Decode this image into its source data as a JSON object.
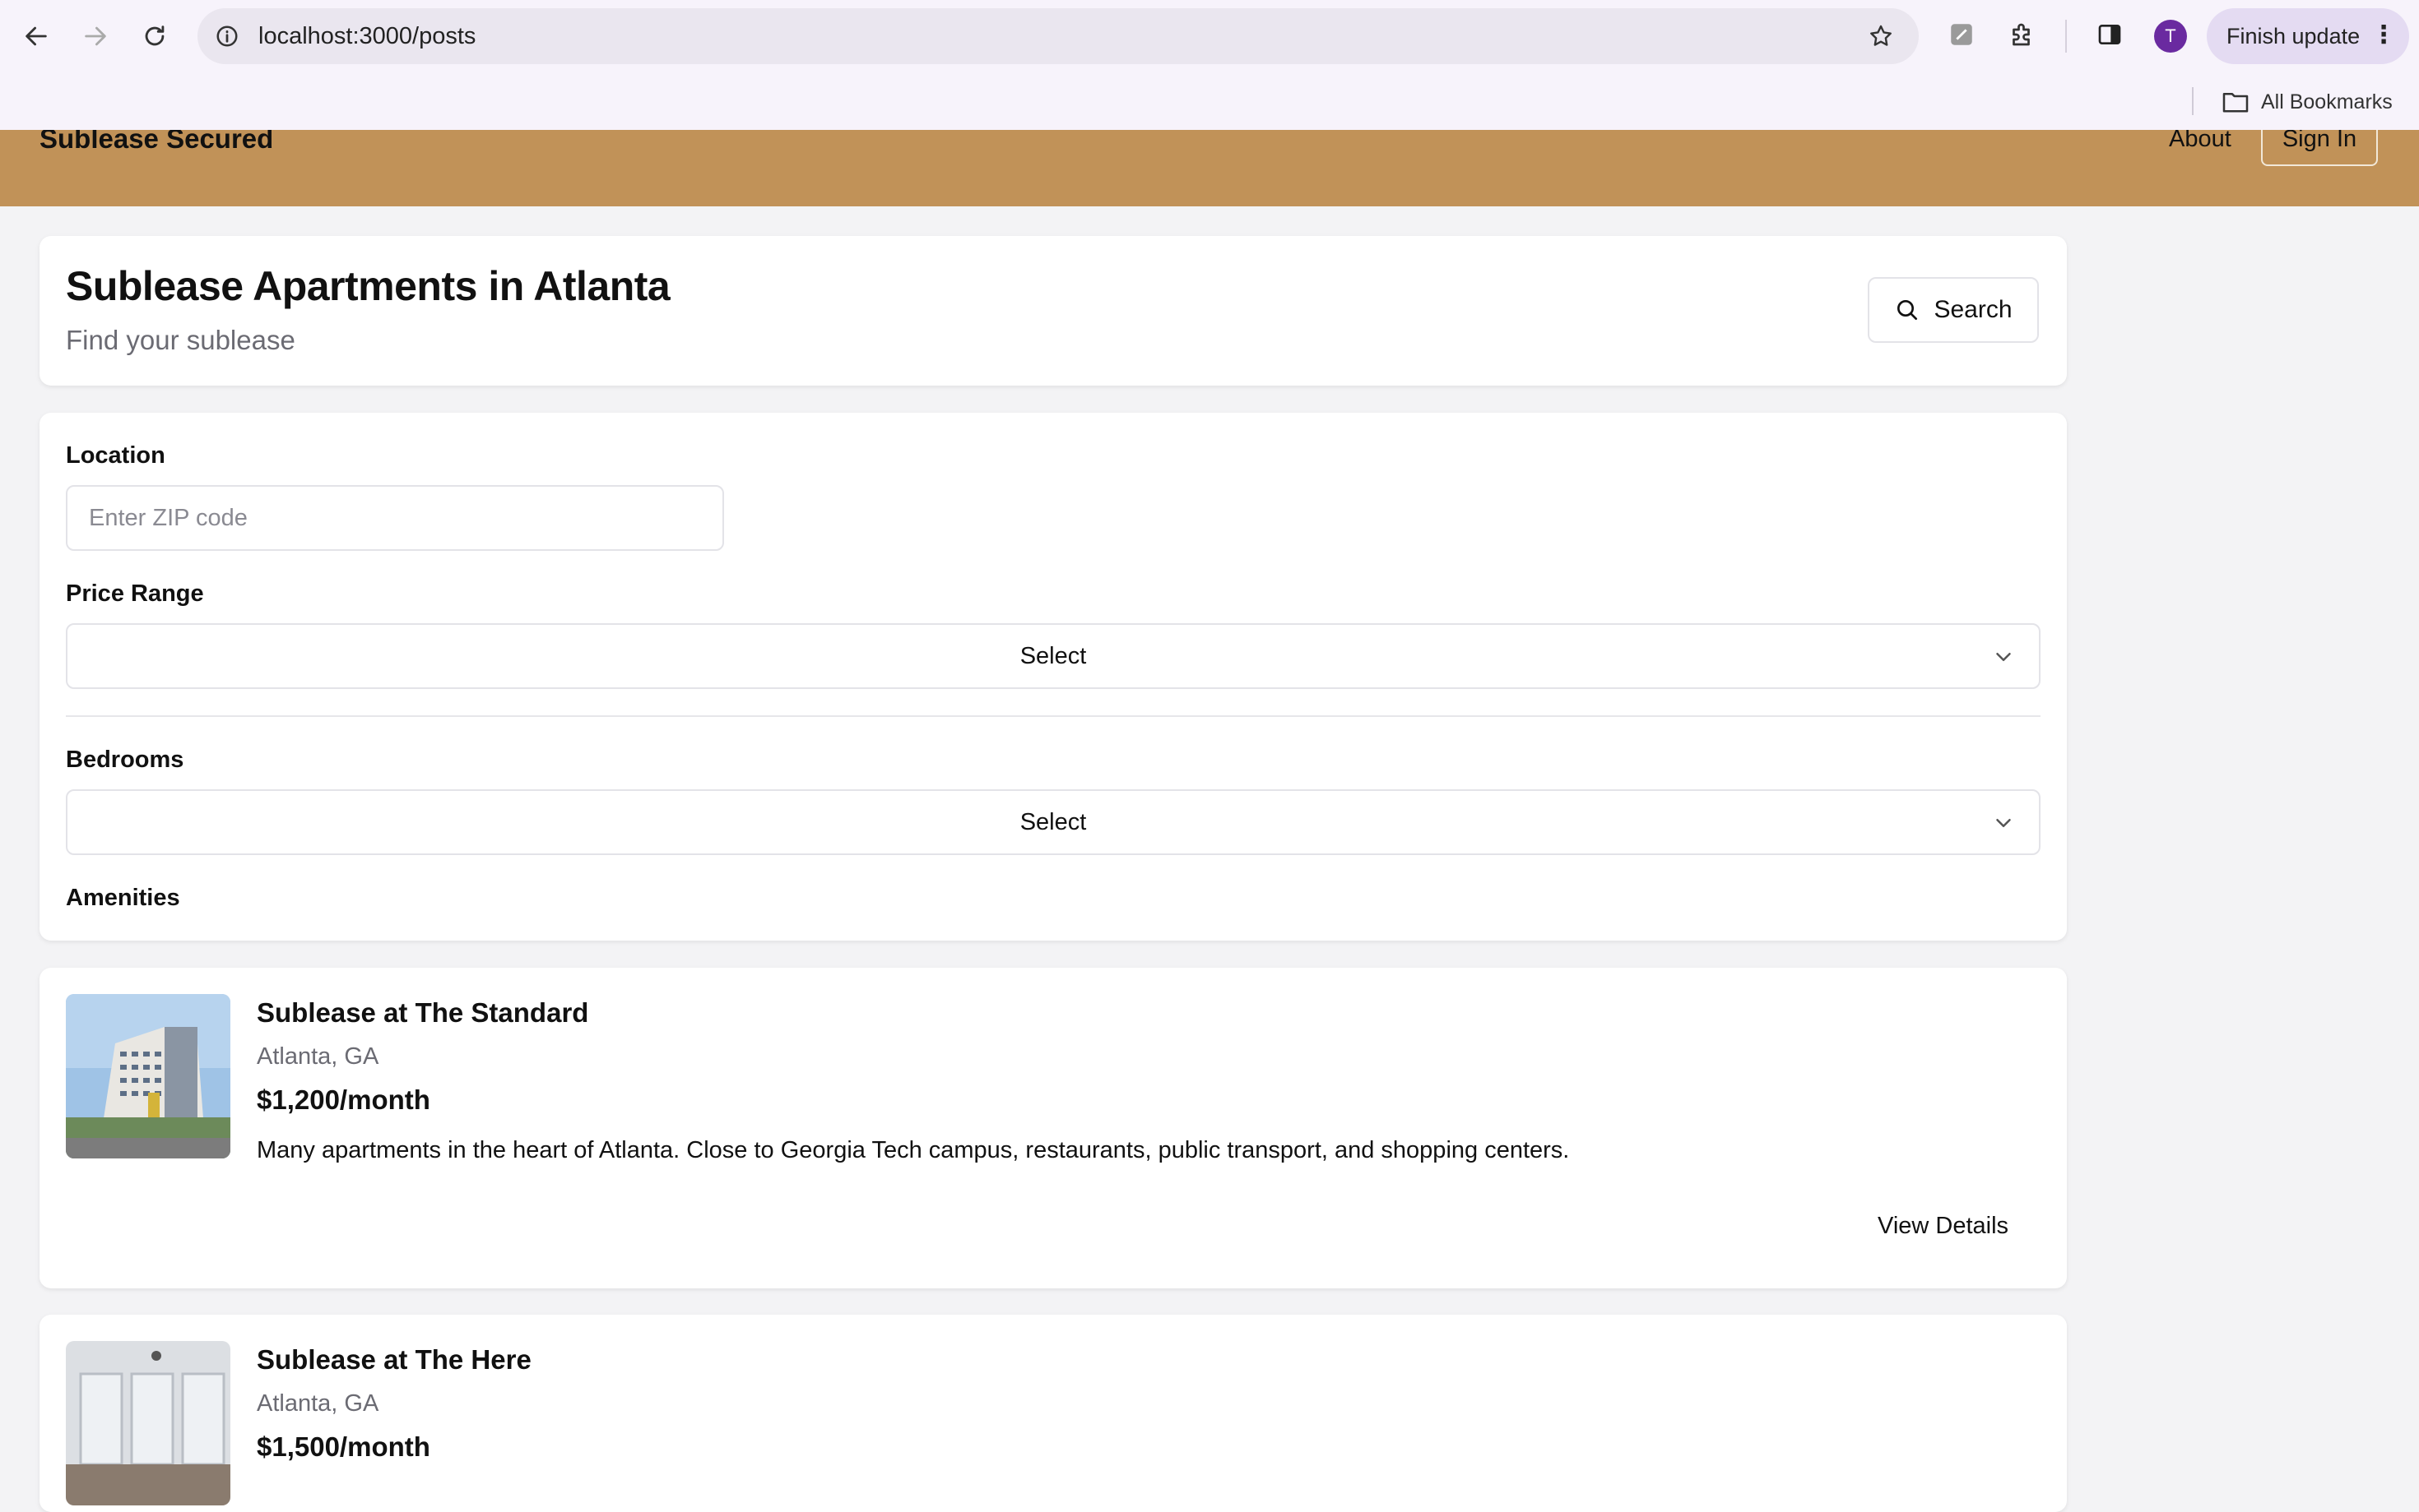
{
  "browser": {
    "url": "localhost:3000/posts",
    "profile_initial": "T",
    "finish_update_label": "Finish update",
    "bookmarks_label": "All Bookmarks"
  },
  "header": {
    "brand": "Sublease Secured",
    "nav_about": "About",
    "sign_in": "Sign In",
    "accent_color": "#c19258"
  },
  "hero": {
    "title": "Sublease Apartments in Atlanta",
    "subtitle": "Find your sublease",
    "search_label": "Search"
  },
  "filters": {
    "location_label": "Location",
    "zip_placeholder": "Enter ZIP code",
    "price_label": "Price Range",
    "price_value": "Select",
    "bedrooms_label": "Bedrooms",
    "bedrooms_value": "Select",
    "amenities_label": "Amenities"
  },
  "listings": [
    {
      "title": "Sublease at The Standard",
      "location": "Atlanta, GA",
      "price": "$1,200/month",
      "description": "Many apartments in the heart of Atlanta. Close to Georgia Tech campus, restaurants, public transport, and shopping centers.",
      "action": "View Details"
    },
    {
      "title": "Sublease at The Here",
      "location": "Atlanta, GA",
      "price": "$1,500/month"
    }
  ]
}
